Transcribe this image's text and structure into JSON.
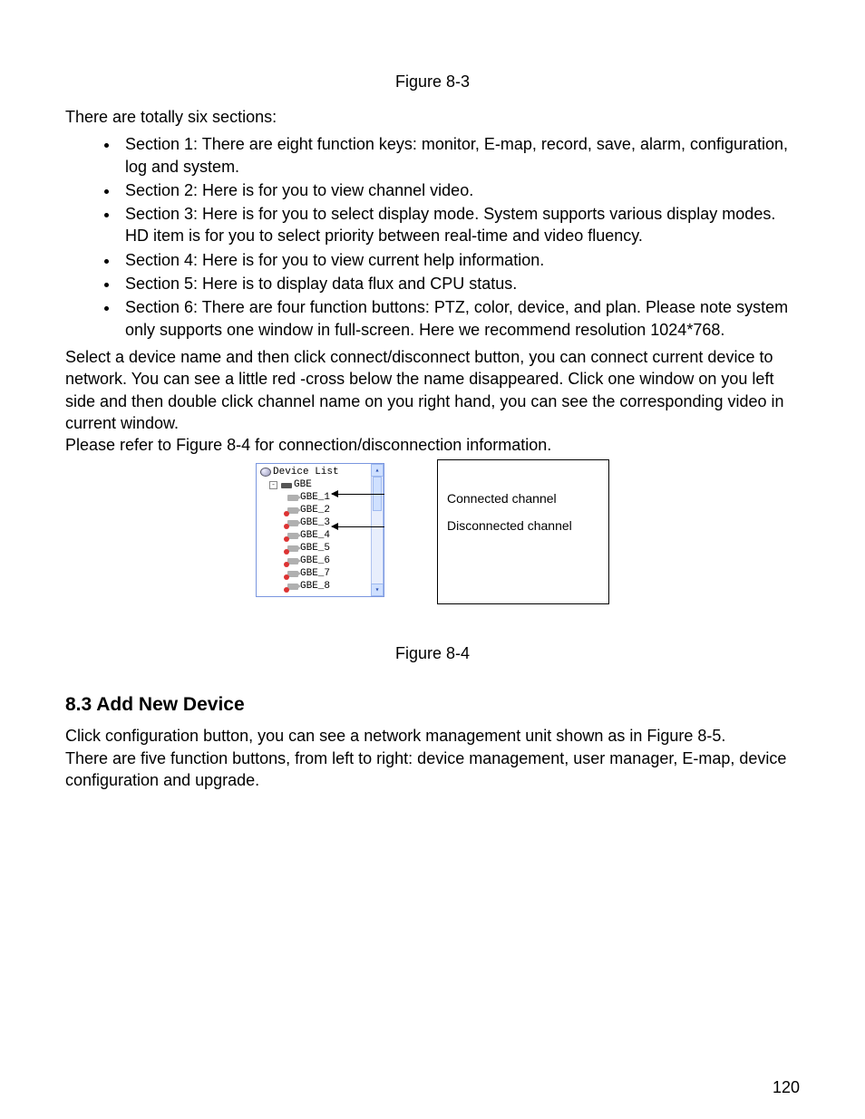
{
  "figure83_caption": "Figure 8-3",
  "intro": "There are totally six sections:",
  "sections": [
    "Section 1: There are eight function keys: monitor, E-map, record, save, alarm, configuration, log and system.",
    "Section 2: Here is for you to view channel video.",
    "Section 3: Here is for you to select display mode. System supports various display modes. HD item is for you to select priority between real-time and video fluency.",
    "Section 4: Here is for you to view current help information.",
    "Section 5: Here is to display data flux and CPU status.",
    "Section 6: There are four function buttons: PTZ, color, device, and plan. Please note system only supports one window in full-screen. Here we recommend resolution 1024*768."
  ],
  "para_connect": "Select a device name and then click connect/disconnect button, you can connect current device to network. You can see a little red -cross below the name disappeared. Click one window on you left side and then double click channel name on you right hand, you can see the corresponding video in current window.",
  "para_refer": "Please refer to Figure 8-4 for connection/disconnection information.",
  "fig84": {
    "tree_title": "Device List",
    "device_root": "GBE",
    "channels": [
      "GBE_1",
      "GBE_2",
      "GBE_3",
      "GBE_4",
      "GBE_5",
      "GBE_6",
      "GBE_7",
      "GBE_8"
    ],
    "label_connected": "Connected channel",
    "label_disconnected": "Disconnected channel",
    "caption": "Figure 8-4"
  },
  "section83": {
    "heading": "8.3  Add New Device",
    "p1": "Click configuration button, you can see a network management unit shown as in Figure 8-5.",
    "p2": "There are five function buttons, from left to right: device management, user manager, E-map, device configuration and upgrade."
  },
  "page_number": "120"
}
